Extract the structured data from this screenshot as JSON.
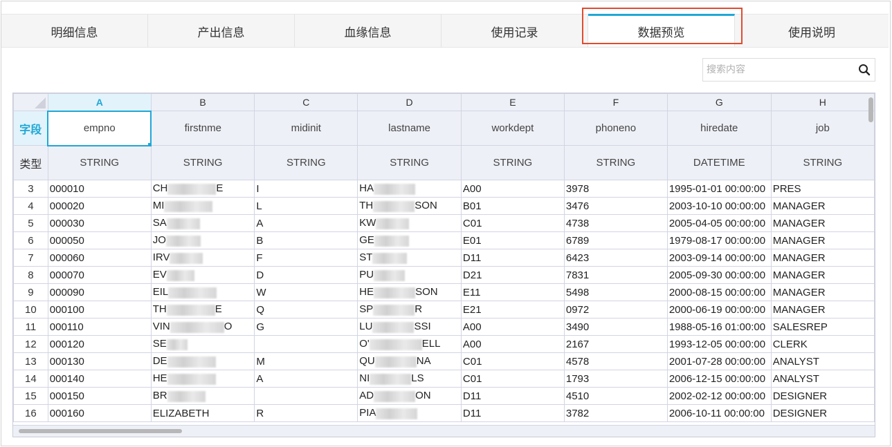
{
  "tabs": [
    {
      "label": "明细信息"
    },
    {
      "label": "产出信息"
    },
    {
      "label": "血缘信息"
    },
    {
      "label": "使用记录"
    },
    {
      "label": "数据预览"
    },
    {
      "label": "使用说明"
    }
  ],
  "active_tab": "数据预览",
  "search": {
    "placeholder": "搜索内容",
    "icon": "search-icon"
  },
  "grid": {
    "columns": [
      "A",
      "B",
      "C",
      "D",
      "E",
      "F",
      "G",
      "H"
    ],
    "selected_column": "A",
    "field_row_label": "字段",
    "type_row_label": "类型",
    "fields": [
      "empno",
      "firstnme",
      "midinit",
      "lastname",
      "workdept",
      "phoneno",
      "hiredate",
      "job"
    ],
    "types": [
      "STRING",
      "STRING",
      "STRING",
      "STRING",
      "STRING",
      "STRING",
      "DATETIME",
      "STRING"
    ],
    "rows": [
      {
        "num": "3",
        "cells": [
          "000010",
          "CH",
          "I",
          "HA",
          "A00",
          "3978",
          "1995-01-01 00:00:00",
          "PRES"
        ]
      },
      {
        "num": "4",
        "cells": [
          "000020",
          "MI",
          "L",
          "TH",
          "B01",
          "3476",
          "2003-10-10 00:00:00",
          "MANAGER"
        ]
      },
      {
        "num": "5",
        "cells": [
          "000030",
          "SA",
          "A",
          "KW",
          "C01",
          "4738",
          "2005-04-05 00:00:00",
          "MANAGER"
        ]
      },
      {
        "num": "6",
        "cells": [
          "000050",
          "JO",
          "B",
          "GE",
          "E01",
          "6789",
          "1979-08-17 00:00:00",
          "MANAGER"
        ]
      },
      {
        "num": "7",
        "cells": [
          "000060",
          "IRV",
          "F",
          "ST",
          "D11",
          "6423",
          "2003-09-14 00:00:00",
          "MANAGER"
        ]
      },
      {
        "num": "8",
        "cells": [
          "000070",
          "EV",
          "D",
          "PU",
          "D21",
          "7831",
          "2005-09-30 00:00:00",
          "MANAGER"
        ]
      },
      {
        "num": "9",
        "cells": [
          "000090",
          "EIL",
          "W",
          "HE",
          "E11",
          "5498",
          "2000-08-15 00:00:00",
          "MANAGER"
        ]
      },
      {
        "num": "10",
        "cells": [
          "000100",
          "TH",
          "Q",
          "SP",
          "E21",
          "0972",
          "2000-06-19 00:00:00",
          "MANAGER"
        ]
      },
      {
        "num": "11",
        "cells": [
          "000110",
          "VIN",
          "G",
          "LU",
          "A00",
          "3490",
          "1988-05-16 01:00:00",
          "SALESREP"
        ]
      },
      {
        "num": "12",
        "cells": [
          "000120",
          "SE",
          "",
          "O'",
          "A00",
          "2167",
          "1993-12-05 00:00:00",
          "CLERK"
        ]
      },
      {
        "num": "13",
        "cells": [
          "000130",
          "DE",
          "M",
          "QU",
          "C01",
          "4578",
          "2001-07-28 00:00:00",
          "ANALYST"
        ]
      },
      {
        "num": "14",
        "cells": [
          "000140",
          "HE",
          "A",
          "NI",
          "C01",
          "1793",
          "2006-12-15 00:00:00",
          "ANALYST"
        ]
      },
      {
        "num": "15",
        "cells": [
          "000150",
          "BR",
          "",
          "AD",
          "D11",
          "4510",
          "2002-02-12 00:00:00",
          "DESIGNER"
        ]
      },
      {
        "num": "16",
        "cells": [
          "000160",
          "ELIZABETH",
          "R",
          "PIA",
          "D11",
          "3782",
          "2006-10-11 00:00:00",
          "DESIGNER"
        ]
      }
    ],
    "name_suffixes": [
      [
        "E",
        ""
      ],
      [
        "",
        "SON"
      ],
      [
        "",
        ""
      ],
      [
        "",
        ""
      ],
      [
        "",
        ""
      ],
      [
        "",
        ""
      ],
      [
        "",
        "SON"
      ],
      [
        "E",
        "R"
      ],
      [
        "O",
        "SSI"
      ],
      [
        "",
        "ELL"
      ],
      [
        "",
        "NA"
      ],
      [
        "",
        "LS"
      ],
      [
        "",
        "ON"
      ],
      [
        "",
        ""
      ]
    ]
  },
  "colors": {
    "accent": "#1fa7d6",
    "highlight_box": "#e04b2f"
  }
}
